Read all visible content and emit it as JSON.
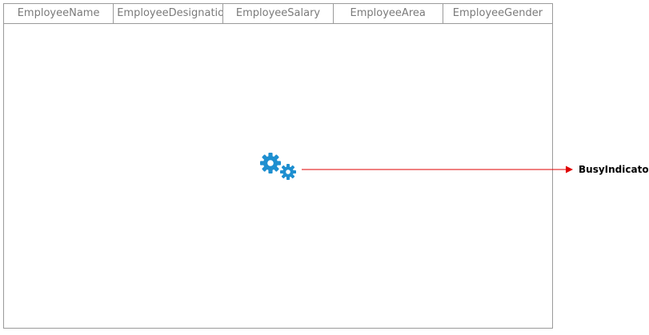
{
  "grid": {
    "columns": [
      {
        "label": "EmployeeName"
      },
      {
        "label": "EmployeeDesignatio"
      },
      {
        "label": "EmployeeSalary"
      },
      {
        "label": "EmployeeArea"
      },
      {
        "label": "EmployeeGender"
      }
    ]
  },
  "busy_indicator": {
    "icon": "gears-icon",
    "color": "#1e8fd0"
  },
  "callout": {
    "label": "BusyIndicator",
    "arrow_color": "#e00000"
  }
}
